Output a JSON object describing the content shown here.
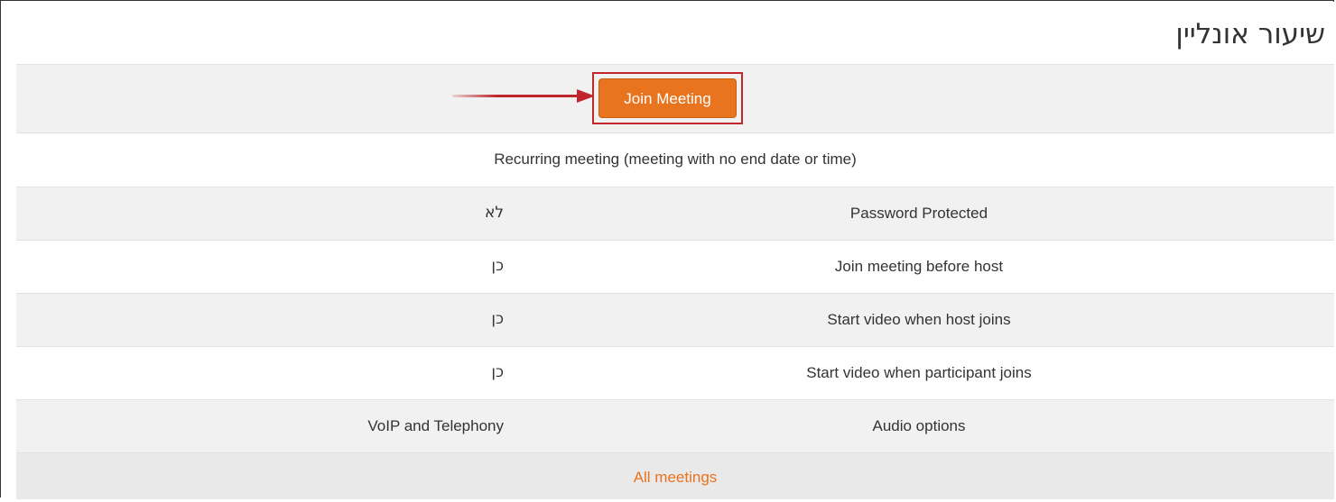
{
  "page": {
    "title": "שיעור אונליין"
  },
  "join": {
    "button_label": "Join Meeting"
  },
  "recurring": {
    "text": "Recurring meeting (meeting with no end date or time)"
  },
  "settings": [
    {
      "label": "Password Protected",
      "value": "לא"
    },
    {
      "label": "Join meeting before host",
      "value": "כן"
    },
    {
      "label": "Start video when host joins",
      "value": "כן"
    },
    {
      "label": "Start video when participant joins",
      "value": "כן"
    },
    {
      "label": "Audio options",
      "value": "VoIP and Telephony"
    }
  ],
  "footer": {
    "link_label": "All meetings"
  },
  "colors": {
    "accent": "#e8741f",
    "highlight_border": "#c0272d",
    "row_alt": "#f1f1f1"
  },
  "icons": {
    "arrow": "arrow-right-icon"
  }
}
